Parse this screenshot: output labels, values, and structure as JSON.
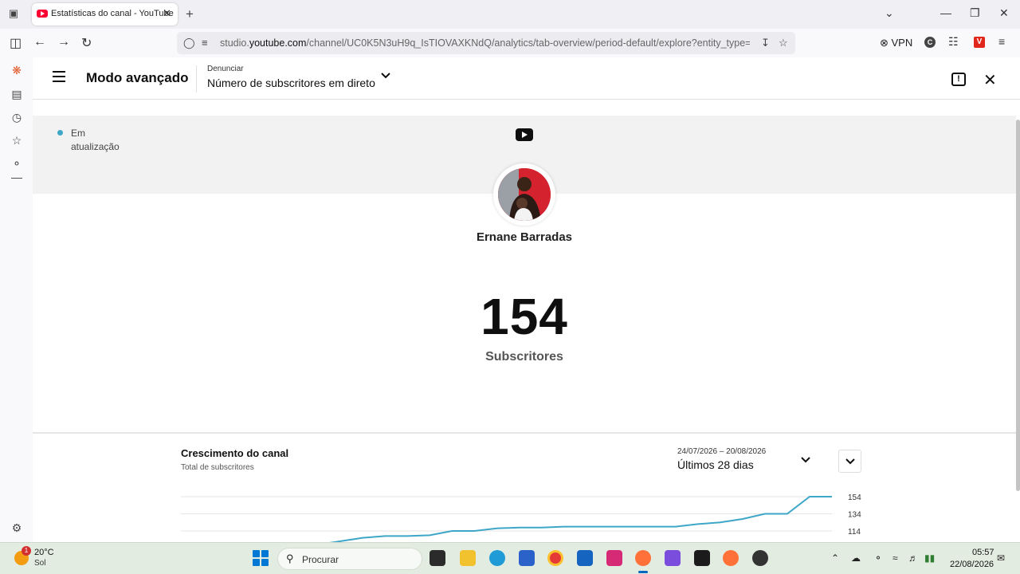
{
  "browser": {
    "tab_title": "Estatísticas do canal - YouTube",
    "url_prefix": "studio.",
    "url_domain": "youtube.com",
    "url_rest": "/channel/UC0K5N3uH9q_IsTIOVAXKNdQ/analytics/tab-overview/period-default/explore?entity_type=CHANNEL",
    "vpn_label": "VPN"
  },
  "header": {
    "mode_title": "Modo avançado",
    "report_label": "Denunciar",
    "report_value": "Número de subscritores em direto"
  },
  "live": {
    "status_text": "Em atualização",
    "channel_name": "Ernane Barradas",
    "subscriber_count": "154",
    "subscriber_label": "Subscritores"
  },
  "growth": {
    "title": "Crescimento do canal",
    "subtitle": "Total de subscritores",
    "date_range": "24/07/2026 – 20/08/2026",
    "period": "Últimos 28 dias"
  },
  "chart_data": {
    "type": "line",
    "series": [
      {
        "values": [
          96,
          98,
          98,
          98,
          98,
          102,
          106,
          108,
          108,
          109,
          114,
          114,
          117,
          118,
          118,
          119,
          119,
          119,
          119,
          119,
          119,
          122,
          124,
          128,
          134,
          134
        ]
      }
    ],
    "y_ticks": [
      "154",
      "134",
      "114"
    ],
    "ylim": [
      94,
      154
    ],
    "line_color": "#3ea6c7",
    "grid": true
  },
  "taskbar": {
    "weather_temp": "20°C",
    "weather_cond": "Sol",
    "weather_badge": "1",
    "search_placeholder": "Procurar",
    "time": "05:57",
    "date": "22/08/2026"
  }
}
